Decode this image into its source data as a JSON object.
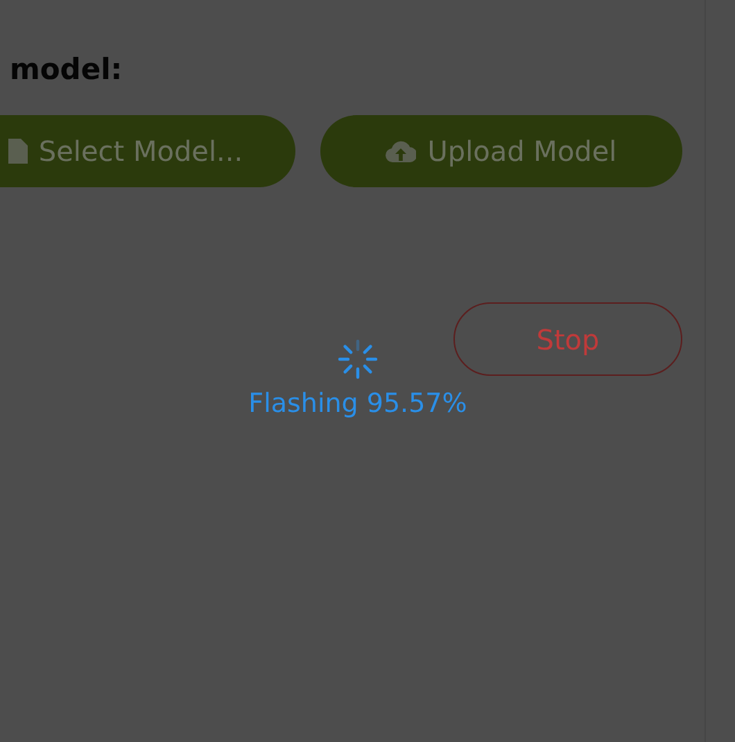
{
  "heading": "model:",
  "buttons": [
    {
      "kind": "select",
      "label": "Select Model..."
    },
    {
      "kind": "upload",
      "label": "Upload Model"
    }
  ],
  "stop_button": {
    "label": "Stop"
  },
  "status": {
    "text": "Flashing 95.57%"
  }
}
